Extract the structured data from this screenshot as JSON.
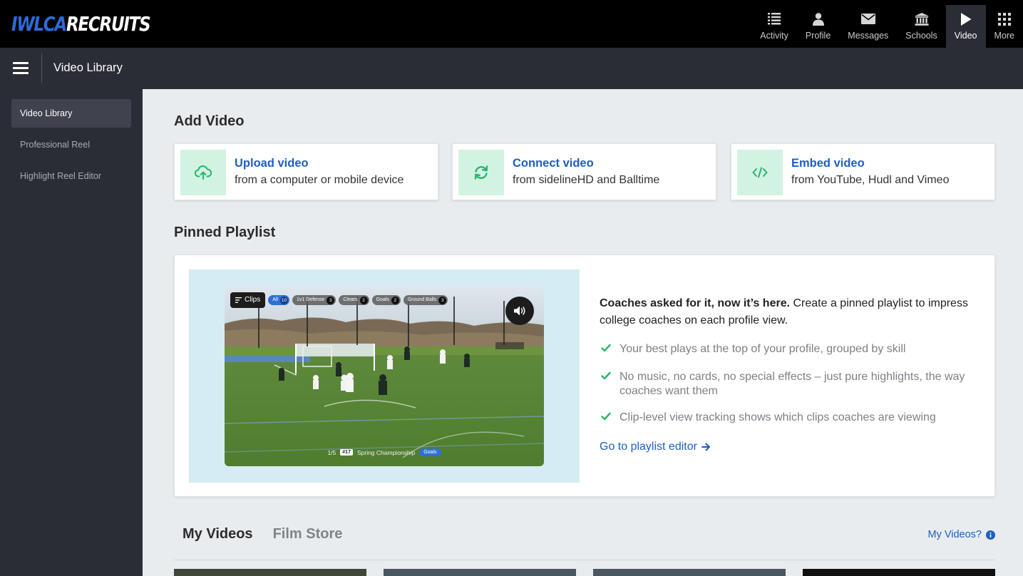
{
  "brand": {
    "logo_a": "IWLCA",
    "logo_b": "RECRUITS",
    "accent": "#2d6bd9"
  },
  "topnav": [
    {
      "label": "Activity",
      "icon": "list-icon"
    },
    {
      "label": "Profile",
      "icon": "person-icon"
    },
    {
      "label": "Messages",
      "icon": "envelope-icon"
    },
    {
      "label": "Schools",
      "icon": "bank-icon"
    },
    {
      "label": "Video",
      "icon": "play-icon",
      "active": true
    },
    {
      "label": "More",
      "icon": "grid-icon"
    }
  ],
  "header": {
    "title": "Video Library"
  },
  "sidebar": {
    "items": [
      {
        "label": "Video Library",
        "active": true
      },
      {
        "label": "Professional Reel"
      },
      {
        "label": "Highlight Reel Editor"
      }
    ]
  },
  "add_video": {
    "heading": "Add Video",
    "cards": [
      {
        "title": "Upload video",
        "subtitle": "from a computer or mobile device",
        "icon": "cloud-upload-icon"
      },
      {
        "title": "Connect video",
        "subtitle": "from sidelineHD and Balltime",
        "icon": "sync-icon"
      },
      {
        "title": "Embed video",
        "subtitle": "from YouTube, Hudl and Vimeo",
        "icon": "code-icon"
      }
    ]
  },
  "pinned": {
    "heading": "Pinned Playlist",
    "video": {
      "clips_label": "Clips",
      "chips": [
        {
          "label": "All",
          "count": "10"
        },
        {
          "label": "1v1 Defense",
          "count": "3"
        },
        {
          "label": "Clears",
          "count": "2"
        },
        {
          "label": "Goals",
          "count": "2"
        },
        {
          "label": "Ground Balls",
          "count": "3"
        }
      ],
      "caption_index": "1/5",
      "caption_jersey": "#17",
      "caption_title": "Spring Championship",
      "caption_tag": "Goals"
    },
    "lead_bold": "Coaches asked for it, now it’s here.",
    "lead_rest": " Create a pinned playlist to impress college coaches on each profile view.",
    "bullets": [
      "Your best plays at the top of your profile, grouped by skill",
      "No music, no cards, no special effects – just pure highlights, the way coaches want them",
      "Clip-level view tracking shows which clips coaches are viewing"
    ],
    "link": "Go to playlist editor"
  },
  "tabs": {
    "my_videos": "My Videos",
    "film_store": "Film Store",
    "help": "My Videos?"
  }
}
